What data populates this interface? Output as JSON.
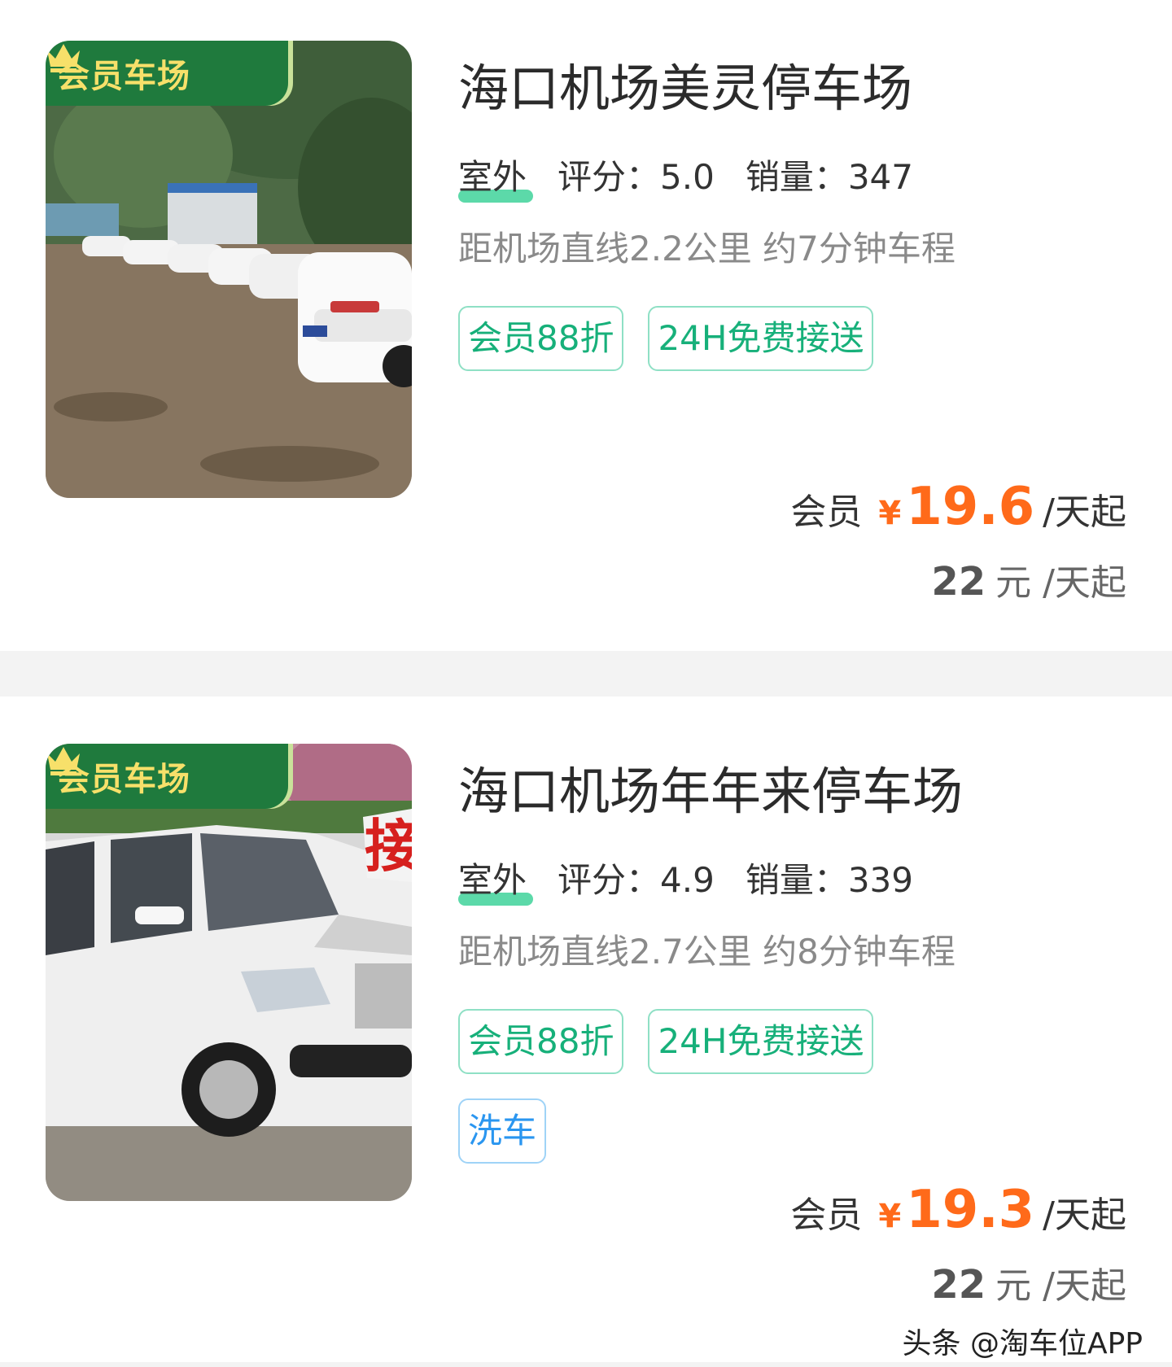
{
  "listings": [
    {
      "badge": "会员车场",
      "title": "海口机场美灵停车场",
      "type": "室外",
      "rating": "评分：5.0",
      "sales": "销量：347",
      "distance": "距机场直线2.2公里 约7分钟车程",
      "tags": [
        "会员88折",
        "24H免费接送"
      ],
      "member_label": "会员",
      "currency": "¥",
      "member_price": "19.6",
      "price_unit": "/天起",
      "original_price": "22",
      "original_currency": "元",
      "original_unit": "/天起"
    },
    {
      "badge": "会员车场",
      "title": "海口机场年年来停车场",
      "type": "室外",
      "rating": "评分：4.9",
      "sales": "销量：339",
      "distance": "距机场直线2.7公里 约8分钟车程",
      "tags": [
        "会员88折",
        "24H免费接送"
      ],
      "extra_tag": "洗车",
      "member_label": "会员",
      "currency": "¥",
      "member_price": "19.3",
      "price_unit": "/天起",
      "original_price": "22",
      "original_currency": "元",
      "original_unit": "/天起"
    }
  ],
  "watermark": "头条 @淘车位APP",
  "colors": {
    "accent_green": "#17b07a",
    "badge_green": "#1f7a3d",
    "badge_text": "#f7e06a",
    "price_orange": "#ff6a1a",
    "wash_blue": "#2a96f0",
    "divider": "#f3f3f3"
  },
  "icons": [
    "crown-icon"
  ]
}
